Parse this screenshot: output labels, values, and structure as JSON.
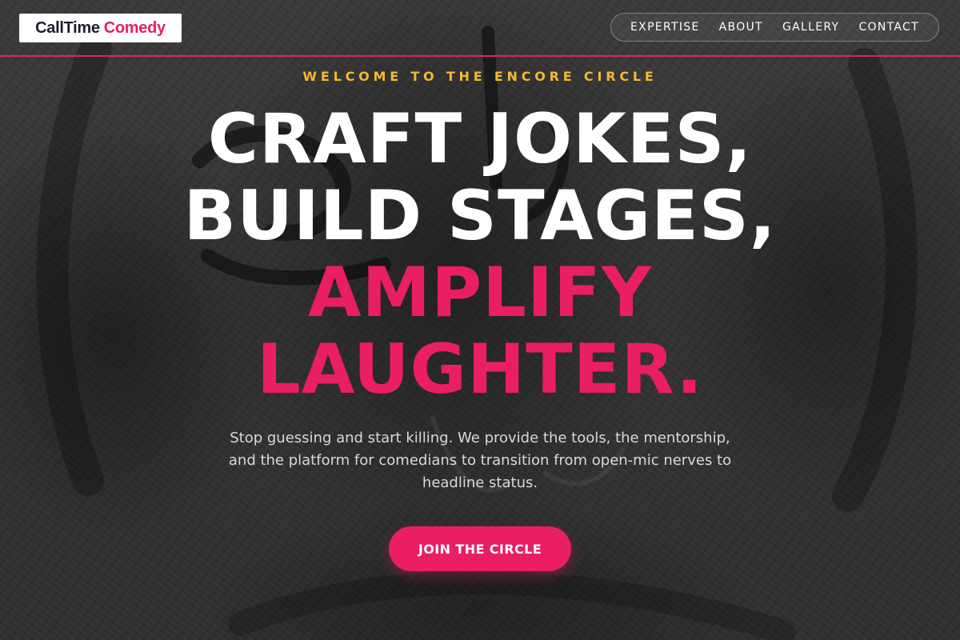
{
  "brand": {
    "name_part1": "CallTime",
    "name_part2": "Comedy"
  },
  "nav": {
    "items": [
      {
        "label": "EXPERTISE"
      },
      {
        "label": "ABOUT"
      },
      {
        "label": "GALLERY"
      },
      {
        "label": "CONTACT"
      }
    ]
  },
  "hero": {
    "eyebrow": "WELCOME TO THE ENCORE CIRCLE",
    "headline_lines": [
      {
        "text": "CRAFT JOKES,"
      },
      {
        "text": "BUILD STAGES,"
      },
      {
        "text": "AMPLIFY"
      },
      {
        "text": "LAUGHTER."
      }
    ],
    "subtitle": "Stop guessing and start killing. We provide the tools, the mentorship, and the platform for comedians to transition from open-mic nerves to headline status.",
    "cta_label": "JOIN THE CIRCLE"
  },
  "colors": {
    "accent": "#e91e63",
    "eyebrow": "#f5b92e",
    "logo_dark": "#1b1f2d"
  }
}
